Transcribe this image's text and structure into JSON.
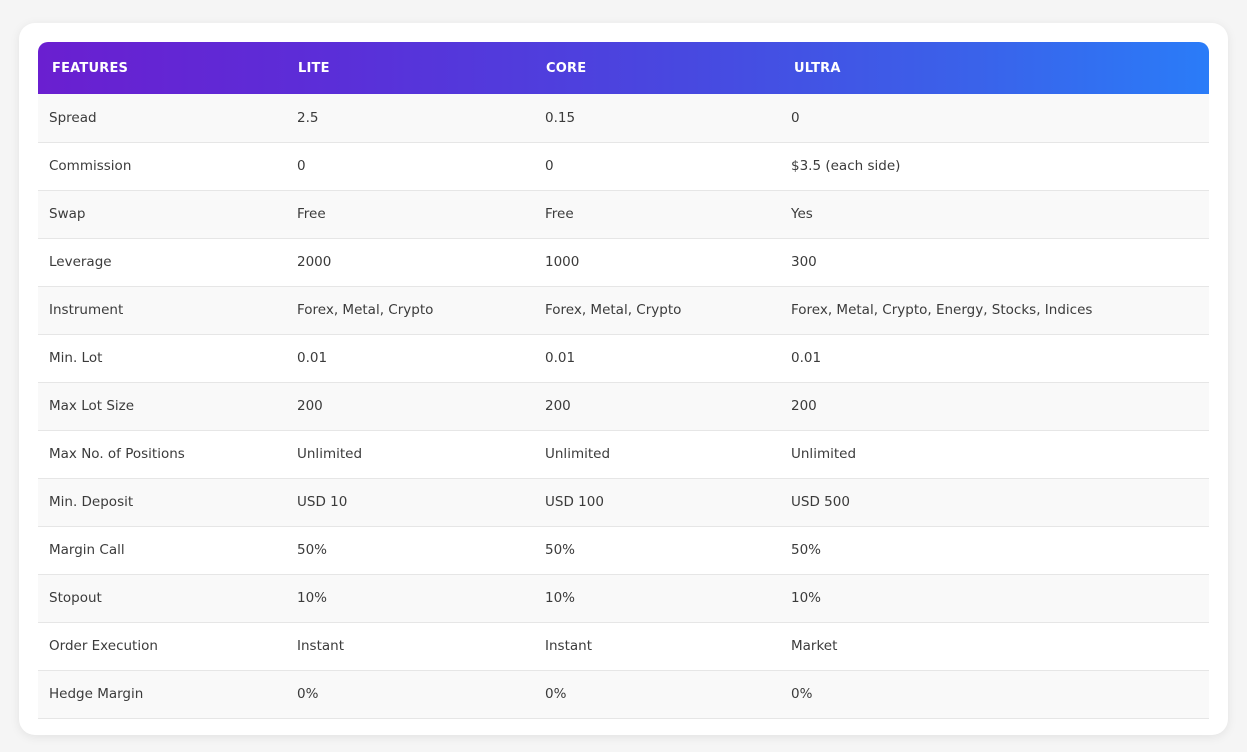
{
  "table": {
    "headers": [
      "FEATURES",
      "LITE",
      "CORE",
      "ULTRA"
    ],
    "rows": [
      [
        "Spread",
        "2.5",
        "0.15",
        "0"
      ],
      [
        "Commission",
        "0",
        "0",
        "$3.5 (each side)"
      ],
      [
        "Swap",
        "Free",
        "Free",
        "Yes"
      ],
      [
        "Leverage",
        "2000",
        "1000",
        "300"
      ],
      [
        "Instrument",
        "Forex, Metal, Crypto",
        "Forex, Metal, Crypto",
        "Forex, Metal, Crypto, Energy, Stocks, Indices"
      ],
      [
        "Min. Lot",
        "0.01",
        "0.01",
        "0.01"
      ],
      [
        "Max Lot Size",
        "200",
        "200",
        "200"
      ],
      [
        "Max No. of Positions",
        "Unlimited",
        "Unlimited",
        "Unlimited"
      ],
      [
        "Min. Deposit",
        "USD 10",
        "USD 100",
        "USD 500"
      ],
      [
        "Margin Call",
        "50%",
        "50%",
        "50%"
      ],
      [
        "Stopout",
        "10%",
        "10%",
        "10%"
      ],
      [
        "Order Execution",
        "Instant",
        "Instant",
        "Market"
      ],
      [
        "Hedge Margin",
        "0%",
        "0%",
        "0%"
      ]
    ]
  },
  "colors": {
    "header_gradient_start": "#6a1fd0",
    "header_gradient_end": "#2a7cf8",
    "row_alt": "#f9f9f9",
    "text": "#3b3b3b"
  }
}
